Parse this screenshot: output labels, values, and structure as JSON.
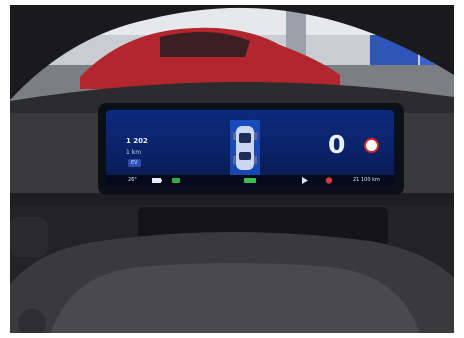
{
  "trip_distance": "1 202",
  "speed": "0",
  "odometer": "21 100 km",
  "range_label": "1 km",
  "mode_label": "EV",
  "temperature": "26°",
  "colors": {
    "screen_blue": "#0d2a7e",
    "dashboard": "#2a2a2c",
    "car_red": "#b3262d",
    "limit_sign_red": "#d22b2b"
  }
}
